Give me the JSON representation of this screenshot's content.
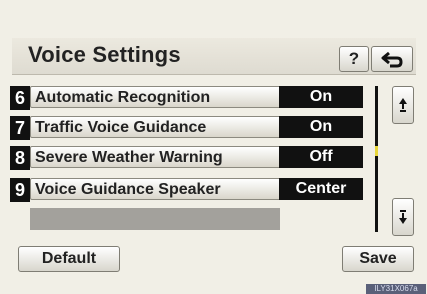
{
  "header": {
    "title": "Voice Settings",
    "help_label": "?"
  },
  "settings_rows": [
    {
      "number": "6",
      "label": "Automatic Recognition",
      "value": "On"
    },
    {
      "number": "7",
      "label": "Traffic Voice Guidance",
      "value": "On"
    },
    {
      "number": "8",
      "label": "Severe Weather Warning",
      "value": "Off"
    },
    {
      "number": "9",
      "label": "Voice Guidance Speaker",
      "value": "Center"
    }
  ],
  "footer": {
    "default_label": "Default",
    "save_label": "Save"
  },
  "reference_code": "ILY31X067a",
  "icons": {
    "back": "back-arrow-icon",
    "scroll_up": "scroll-up-icon",
    "scroll_down": "scroll-down-icon"
  },
  "colors": {
    "value_box": "#111111",
    "scroll_indicator": "#e8d73a"
  }
}
